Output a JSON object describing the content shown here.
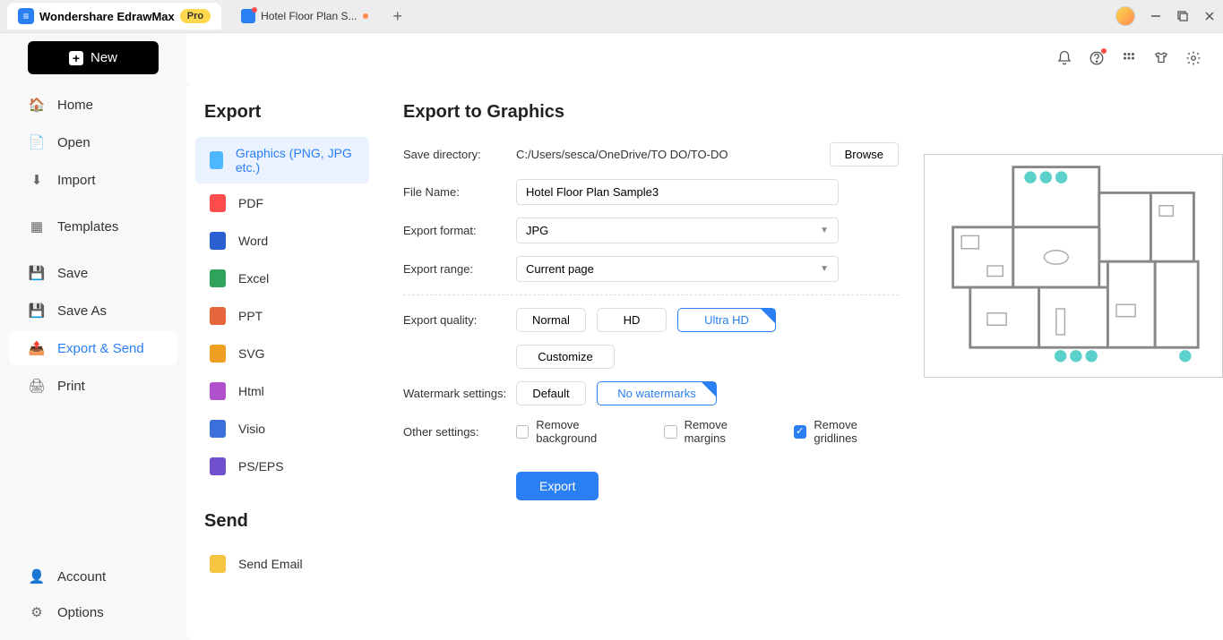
{
  "title_bar": {
    "app_name": "Wondershare EdrawMax",
    "pro_badge": "Pro",
    "doc_tab": "Hotel Floor Plan S..."
  },
  "new_button": "New",
  "sidebar": {
    "items": [
      {
        "label": "Home"
      },
      {
        "label": "Open"
      },
      {
        "label": "Import"
      },
      {
        "label": "Templates"
      },
      {
        "label": "Save"
      },
      {
        "label": "Save As"
      },
      {
        "label": "Export & Send"
      },
      {
        "label": "Print"
      }
    ],
    "bottom": [
      {
        "label": "Account"
      },
      {
        "label": "Options"
      }
    ]
  },
  "export_panel": {
    "heading1": "Export",
    "items": [
      {
        "label": "Graphics (PNG, JPG etc.)"
      },
      {
        "label": "PDF"
      },
      {
        "label": "Word"
      },
      {
        "label": "Excel"
      },
      {
        "label": "PPT"
      },
      {
        "label": "SVG"
      },
      {
        "label": "Html"
      },
      {
        "label": "Visio"
      },
      {
        "label": "PS/EPS"
      }
    ],
    "heading2": "Send",
    "send_items": [
      {
        "label": "Send Email"
      }
    ]
  },
  "form": {
    "title": "Export to Graphics",
    "save_dir_label": "Save directory:",
    "save_dir_value": "C:/Users/sesca/OneDrive/TO DO/TO-DO",
    "browse": "Browse",
    "file_name_label": "File Name:",
    "file_name_value": "Hotel Floor Plan Sample3",
    "format_label": "Export format:",
    "format_value": "JPG",
    "range_label": "Export range:",
    "range_value": "Current page",
    "quality_label": "Export quality:",
    "quality_options": [
      "Normal",
      "HD",
      "Ultra HD"
    ],
    "quality_selected": "Ultra HD",
    "customize": "Customize",
    "watermark_label": "Watermark settings:",
    "watermark_options": [
      "Default",
      "No watermarks"
    ],
    "watermark_selected": "No watermarks",
    "other_label": "Other settings:",
    "remove_bg": "Remove background",
    "remove_margins": "Remove margins",
    "remove_gridlines": "Remove gridlines",
    "gridlines_checked": true,
    "export_btn": "Export"
  }
}
